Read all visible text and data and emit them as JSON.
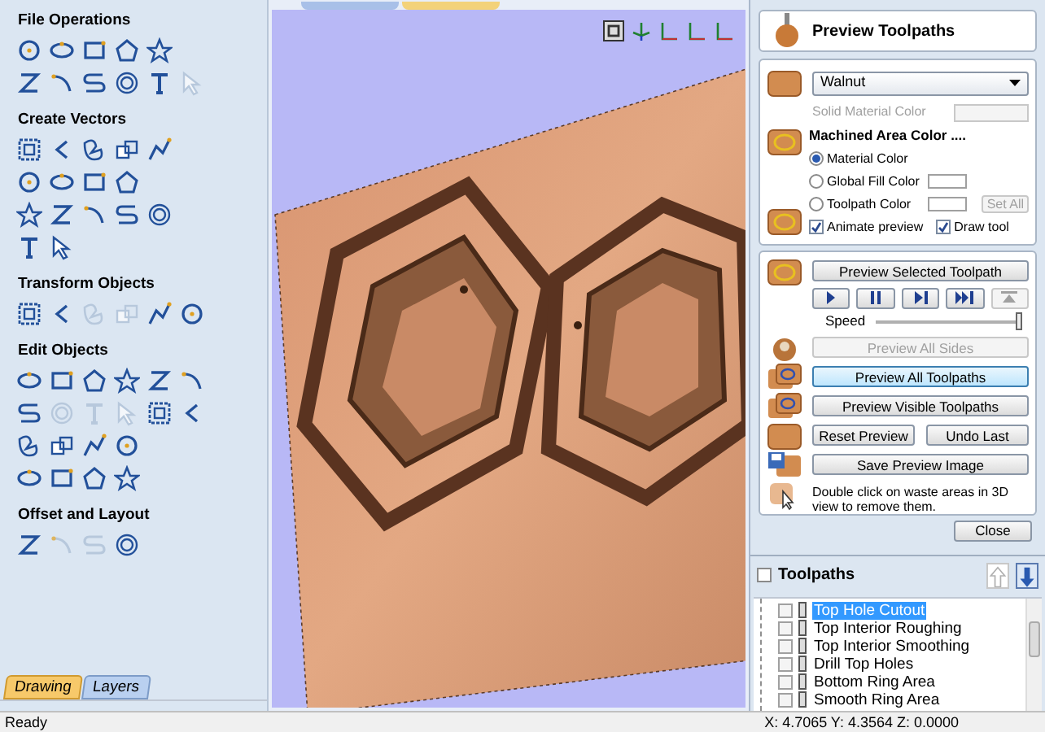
{
  "left_panel": {
    "sections": [
      {
        "title": "File Operations",
        "tool_rows": [
          [
            {
              "disabled": false
            },
            {
              "disabled": false
            },
            {
              "disabled": false
            },
            {
              "disabled": false
            },
            {
              "disabled": false
            }
          ],
          [
            {
              "disabled": false
            },
            {
              "disabled": false
            },
            {
              "disabled": false
            },
            {
              "disabled": false
            },
            {
              "disabled": false
            },
            {
              "disabled": true
            }
          ]
        ]
      },
      {
        "title": "Create Vectors",
        "tool_rows": [
          [
            {
              "disabled": false
            },
            {
              "disabled": false
            },
            {
              "disabled": false
            },
            {
              "disabled": false
            },
            {
              "disabled": false
            }
          ],
          [
            {
              "disabled": false
            },
            {
              "disabled": false
            },
            {
              "disabled": false
            },
            {
              "disabled": false
            }
          ],
          [
            {
              "disabled": false
            },
            {
              "disabled": false
            },
            {
              "disabled": false
            },
            {
              "disabled": false
            },
            {
              "disabled": false
            }
          ],
          [
            {
              "disabled": false
            },
            {
              "disabled": false
            }
          ]
        ]
      },
      {
        "title": "Transform Objects",
        "tool_rows": [
          [
            {
              "disabled": false
            },
            {
              "disabled": false
            },
            {
              "disabled": true
            },
            {
              "disabled": true
            },
            {
              "disabled": false
            },
            {
              "disabled": false
            }
          ]
        ]
      },
      {
        "title": "Edit Objects",
        "tool_rows": [
          [
            {
              "disabled": false
            },
            {
              "disabled": false
            },
            {
              "disabled": false
            },
            {
              "disabled": false
            },
            {
              "disabled": false
            },
            {
              "disabled": false
            }
          ],
          [
            {
              "disabled": false
            },
            {
              "disabled": true
            },
            {
              "disabled": true
            },
            {
              "disabled": true
            },
            {
              "disabled": false
            },
            {
              "disabled": false
            }
          ],
          [
            {
              "disabled": false
            },
            {
              "disabled": false
            },
            {
              "disabled": false
            },
            {
              "disabled": false
            }
          ],
          [
            {
              "disabled": false
            },
            {
              "disabled": false
            },
            {
              "disabled": false
            },
            {
              "disabled": false
            }
          ]
        ]
      },
      {
        "title": "Offset and Layout",
        "tool_rows": [
          [
            {
              "disabled": false
            },
            {
              "disabled": true
            },
            {
              "disabled": true
            },
            {
              "disabled": false
            }
          ]
        ]
      }
    ],
    "tabs": [
      {
        "label": "Drawing",
        "selected": true
      },
      {
        "label": "Layers",
        "selected": false
      }
    ]
  },
  "view": {
    "tabs": [
      {
        "selected": false
      },
      {
        "selected": true
      }
    ]
  },
  "preview_panel": {
    "title": "Preview Toolpaths",
    "material": {
      "value": "Walnut"
    },
    "solid_material_color": {
      "label": "Solid Material Color",
      "disabled": true
    },
    "machined_area_color": {
      "label": "Machined Area Color ...."
    },
    "color_options": [
      {
        "label": "Material Color",
        "selected": true,
        "swatch": false
      },
      {
        "label": "Global Fill Color",
        "selected": false,
        "swatch": true
      },
      {
        "label": "Toolpath Color",
        "selected": false,
        "swatch": true
      }
    ],
    "set_all": {
      "label": "Set All",
      "disabled": true
    },
    "checkboxes": [
      {
        "label": "Animate preview",
        "checked": true
      },
      {
        "label": "Draw tool",
        "checked": true
      }
    ],
    "preview_selected": {
      "label": "Preview Selected Toolpath"
    },
    "playback_buttons": [
      {
        "kind": "play",
        "disabled": false
      },
      {
        "kind": "pause",
        "disabled": false
      },
      {
        "kind": "step",
        "disabled": false
      },
      {
        "kind": "end",
        "disabled": false
      },
      {
        "kind": "reset",
        "disabled": true
      }
    ],
    "speed": {
      "label": "Speed",
      "level": 1.0
    },
    "actions": [
      {
        "label": "Preview All Sides",
        "disabled": true,
        "focused": false
      },
      {
        "label": "Preview All Toolpaths",
        "disabled": false,
        "focused": true
      },
      {
        "label": "Preview Visible Toolpaths",
        "disabled": false,
        "focused": false
      }
    ],
    "reset": {
      "label": "Reset Preview"
    },
    "undo": {
      "label": "Undo Last"
    },
    "save_image": {
      "label": "Save Preview Image"
    },
    "hint": "Double click on waste areas in 3D view to remove them.",
    "close": {
      "label": "Close"
    }
  },
  "toolpaths": {
    "title": "Toolpaths",
    "all_checked": false,
    "move_up_disabled": true,
    "items": [
      {
        "name": "Top Hole Cutout",
        "checked": false,
        "selected": true
      },
      {
        "name": "Top Interior Roughing",
        "checked": false,
        "selected": false
      },
      {
        "name": "Top Interior Smoothing",
        "checked": false,
        "selected": false
      },
      {
        "name": "Drill Top Holes",
        "checked": false,
        "selected": false
      },
      {
        "name": "Bottom Ring Area",
        "checked": false,
        "selected": false
      },
      {
        "name": "Smooth Ring Area",
        "checked": false,
        "selected": false
      }
    ]
  },
  "status_bar": {
    "message": "Ready",
    "coordinates": "X: 4.7065 Y: 4.3564 Z: 0.0000"
  }
}
